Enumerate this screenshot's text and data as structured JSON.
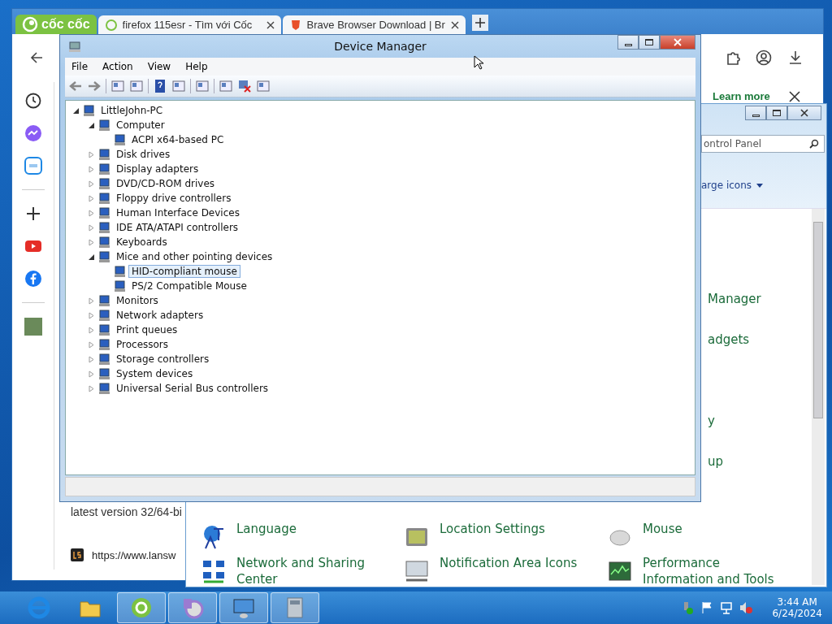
{
  "browser": {
    "logo": "cốc cốc",
    "tabs": [
      {
        "label": "firefox 115esr - Tìm với Cốc"
      },
      {
        "label": "Brave Browser Download | Br"
      }
    ],
    "banner_link": "Learn more",
    "page_text": "latest version 32/64-bi",
    "result_url": "https://www.lansw"
  },
  "control_panel": {
    "search_placeholder": "ontrol Panel",
    "view_by": "arge icons",
    "hidden_items": [
      "Manager",
      "adgets",
      "y",
      "up"
    ],
    "items": [
      {
        "label": "Language",
        "kind": "language"
      },
      {
        "label": "Location Settings",
        "kind": "location"
      },
      {
        "label": "Mouse",
        "kind": "mouse"
      },
      {
        "label": "Network and Sharing Center",
        "kind": "network"
      },
      {
        "label": "Notification Area Icons",
        "kind": "notification"
      },
      {
        "label": "Performance Information and Tools",
        "kind": "performance"
      }
    ]
  },
  "device_manager": {
    "title": "Device Manager",
    "menu": [
      "File",
      "Action",
      "View",
      "Help"
    ],
    "tree": [
      {
        "label": "LittleJohn-PC",
        "expanded": true,
        "selected": false,
        "children": [
          {
            "label": "Computer",
            "expanded": true,
            "selected": false,
            "children": [
              {
                "label": "ACPI x64-based PC",
                "selected": false
              }
            ]
          },
          {
            "label": "Disk drives",
            "expanded": false,
            "selected": false
          },
          {
            "label": "Display adapters",
            "expanded": false,
            "selected": false
          },
          {
            "label": "DVD/CD-ROM drives",
            "expanded": false,
            "selected": false
          },
          {
            "label": "Floppy drive controllers",
            "expanded": false,
            "selected": false
          },
          {
            "label": "Human Interface Devices",
            "expanded": false,
            "selected": false
          },
          {
            "label": "IDE ATA/ATAPI controllers",
            "expanded": false,
            "selected": false
          },
          {
            "label": "Keyboards",
            "expanded": false,
            "selected": false
          },
          {
            "label": "Mice and other pointing devices",
            "expanded": true,
            "selected": false,
            "children": [
              {
                "label": "HID-compliant mouse",
                "selected": true
              },
              {
                "label": "PS/2 Compatible Mouse",
                "selected": false
              }
            ]
          },
          {
            "label": "Monitors",
            "expanded": false,
            "selected": false
          },
          {
            "label": "Network adapters",
            "expanded": false,
            "selected": false
          },
          {
            "label": "Print queues",
            "expanded": false,
            "selected": false
          },
          {
            "label": "Processors",
            "expanded": false,
            "selected": false
          },
          {
            "label": "Storage controllers",
            "expanded": false,
            "selected": false
          },
          {
            "label": "System devices",
            "expanded": false,
            "selected": false
          },
          {
            "label": "Universal Serial Bus controllers",
            "expanded": false,
            "selected": false
          }
        ]
      }
    ]
  },
  "taskbar": {
    "apps": [
      {
        "kind": "ie",
        "selected": false
      },
      {
        "kind": "explorer",
        "selected": false
      },
      {
        "kind": "browser",
        "selected": true
      },
      {
        "kind": "media",
        "selected": true
      },
      {
        "kind": "controlpanel",
        "selected": true
      },
      {
        "kind": "devicemanager",
        "selected": true
      }
    ],
    "time": "3:44 AM",
    "date": "6/24/2024"
  }
}
